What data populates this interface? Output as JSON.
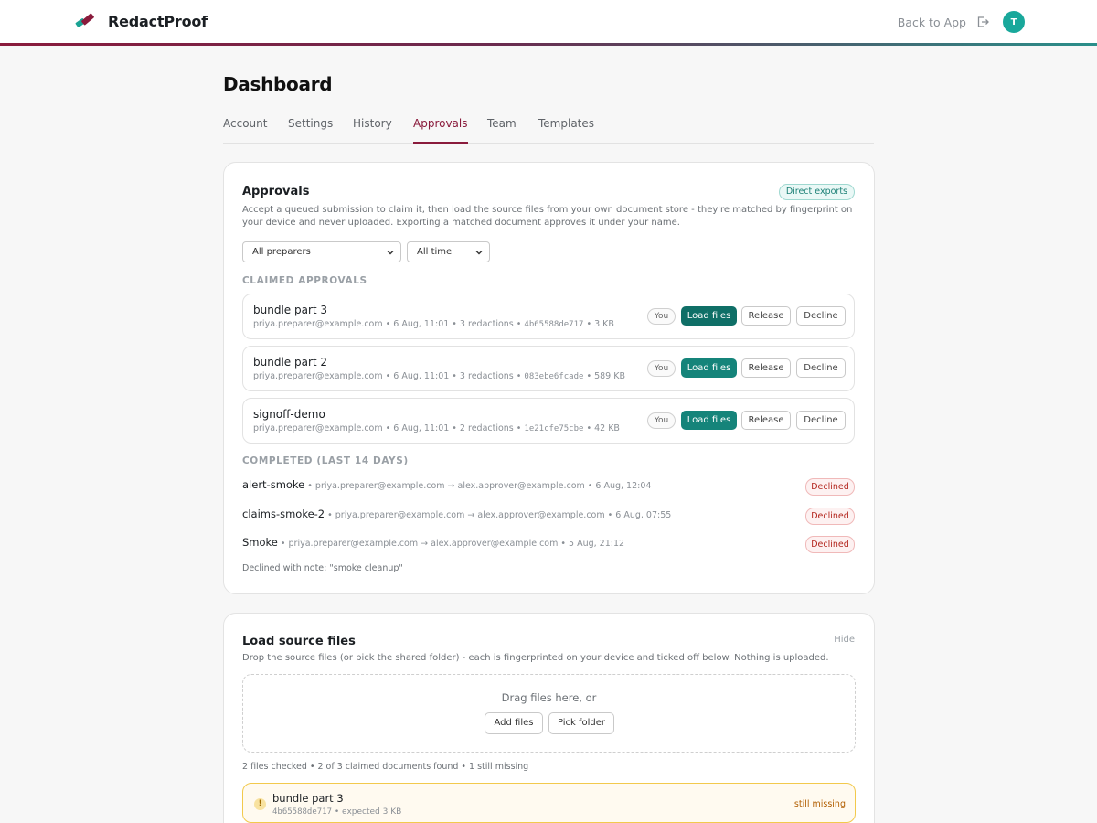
{
  "header": {
    "brand": "RedactProof",
    "back_link": "Back to App",
    "avatar_initial": "T"
  },
  "page": {
    "title": "Dashboard",
    "tabs": [
      {
        "label": "Account"
      },
      {
        "label": "Settings"
      },
      {
        "label": "History"
      },
      {
        "label": "Approvals",
        "active": true
      },
      {
        "label": "Team"
      },
      {
        "label": "Templates"
      }
    ]
  },
  "approvals": {
    "title": "Approvals",
    "badge": "Direct exports",
    "description": "Accept a queued submission to claim it, then load the source files from your own document store - they're matched by fingerprint on your device and never uploaded. Exporting a matched document approves it under your name.",
    "filters": {
      "preparer": "All preparers",
      "time": "All time"
    },
    "claimed_label": "CLAIMED APPROVALS",
    "claimed": [
      {
        "name": "bundle part 3",
        "meta": "priya.preparer@example.com • 6 Aug, 11:01 • 3 redactions • ",
        "hash": "4b65588de717",
        "size": " • 3 KB",
        "you": "You",
        "load": "Load files",
        "release": "Release",
        "decline": "Decline"
      },
      {
        "name": "bundle part 2",
        "meta": "priya.preparer@example.com • 6 Aug, 11:01 • 3 redactions • ",
        "hash": "083ebe6fcade",
        "size": " • 589 KB",
        "you": "You",
        "load": "Load files",
        "release": "Release",
        "decline": "Decline"
      },
      {
        "name": "signoff-demo",
        "meta": "priya.preparer@example.com • 6 Aug, 11:01 • 2 redactions • ",
        "hash": "1e21cfe75cbe",
        "size": " • 42 KB",
        "you": "You",
        "load": "Load files",
        "release": "Release",
        "decline": "Decline"
      }
    ],
    "completed_label": "COMPLETED (LAST 14 DAYS)",
    "completed": [
      {
        "name": "alert-smoke",
        "meta": " • priya.preparer@example.com → alex.approver@example.com • 6 Aug, 12:04",
        "status": "Declined"
      },
      {
        "name": "claims-smoke-2",
        "meta": " • priya.preparer@example.com → alex.approver@example.com • 6 Aug, 07:55",
        "status": "Declined"
      },
      {
        "name": "Smoke",
        "meta": " • priya.preparer@example.com → alex.approver@example.com • 5 Aug, 21:12",
        "status": "Declined"
      }
    ],
    "note": "Declined with note: \"smoke cleanup\""
  },
  "load_files": {
    "title": "Load source files",
    "hide": "Hide",
    "description": "Drop the source files (or pick the shared folder) - each is fingerprinted on your device and ticked off below. Nothing is uploaded.",
    "drop_text": "Drag files here, or",
    "add_files": "Add files",
    "pick_folder": "Pick folder",
    "status": "2 files checked • 2 of 3 claimed documents found • 1 still missing",
    "missing": {
      "name": "bundle part 3",
      "hash": "4b65588de717",
      "expected": " • expected 3 KB",
      "status": "still missing"
    }
  },
  "colors": {
    "brand_maroon": "#8a1b3c",
    "teal": "#15847a",
    "declined_red": "#b3261e",
    "warning_yellow": "#f2c94c"
  }
}
